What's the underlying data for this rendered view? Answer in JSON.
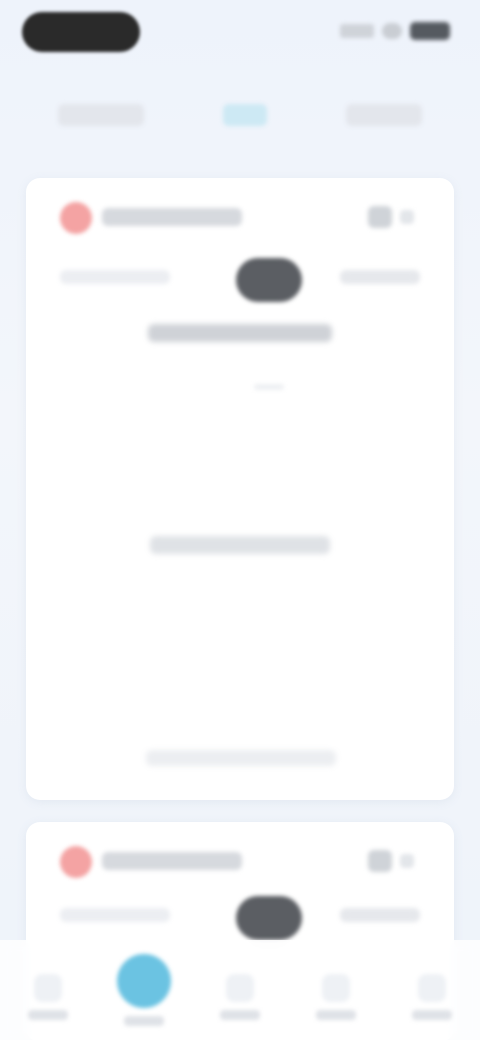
{
  "status_bar": {
    "time": "",
    "icons": [
      "signal-icon",
      "wifi-icon",
      "battery-icon"
    ]
  },
  "top_tabs": [
    {
      "label": ""
    },
    {
      "label": ""
    },
    {
      "label": ""
    }
  ],
  "cards": [
    {
      "brand": "",
      "score": "",
      "team_left": "",
      "team_right": "",
      "subline": "",
      "mid_line": "",
      "bottom_line": ""
    },
    {
      "brand": "",
      "score": "",
      "team_left": "",
      "team_right": ""
    }
  ],
  "bottom_nav": [
    {
      "icon": "home-icon",
      "label": ""
    },
    {
      "icon": "active-icon",
      "label": ""
    },
    {
      "icon": "list-icon",
      "label": ""
    },
    {
      "icon": "chart-icon",
      "label": ""
    },
    {
      "icon": "profile-icon",
      "label": ""
    }
  ],
  "colors": {
    "background": "#eef3fb",
    "card": "#ffffff",
    "accent": "#6bc3e2",
    "brand_logo": "#f4a3a3",
    "score_pill": "#5b5e63"
  }
}
